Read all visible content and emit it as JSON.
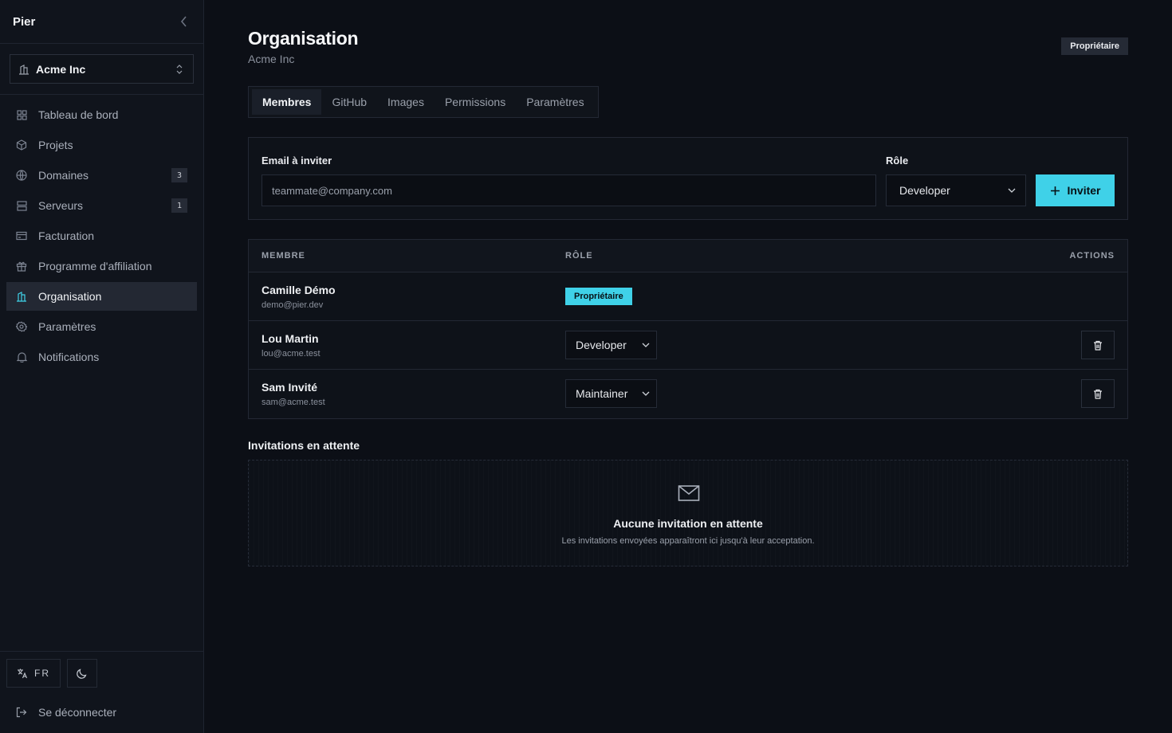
{
  "app": {
    "brand": "Pier"
  },
  "org_switcher": {
    "name": "Acme Inc"
  },
  "nav": [
    {
      "label": "Tableau de bord",
      "icon": "dashboard-icon",
      "count": null
    },
    {
      "label": "Projets",
      "icon": "box-icon",
      "count": null
    },
    {
      "label": "Domaines",
      "icon": "globe-icon",
      "count": "3"
    },
    {
      "label": "Serveurs",
      "icon": "server-icon",
      "count": "1"
    },
    {
      "label": "Facturation",
      "icon": "credit-card-icon",
      "count": null
    },
    {
      "label": "Programme d'affiliation",
      "icon": "gift-icon",
      "count": null
    },
    {
      "label": "Organisation",
      "icon": "building-icon",
      "count": null,
      "active": true
    },
    {
      "label": "Paramètres",
      "icon": "gear-icon",
      "count": null
    },
    {
      "label": "Notifications",
      "icon": "bell-icon",
      "count": null
    }
  ],
  "footer": {
    "language": "FR",
    "logout": "Se déconnecter"
  },
  "page": {
    "title": "Organisation",
    "subtitle": "Acme Inc",
    "role_chip": "Propriétaire"
  },
  "tabs": [
    "Membres",
    "GitHub",
    "Images",
    "Permissions",
    "Paramètres"
  ],
  "invite": {
    "email_label": "Email à inviter",
    "email_placeholder": "teammate@company.com",
    "role_label": "Rôle",
    "role_value": "Developer",
    "button": "Inviter"
  },
  "members": {
    "headers": {
      "member": "MEMBRE",
      "role": "RÔLE",
      "actions": "ACTIONS"
    },
    "rows": [
      {
        "name": "Camille Démo",
        "email": "demo@pier.dev",
        "role": "Propriétaire",
        "owner": true
      },
      {
        "name": "Lou Martin",
        "email": "lou@acme.test",
        "role": "Developer",
        "owner": false
      },
      {
        "name": "Sam Invité",
        "email": "sam@acme.test",
        "role": "Maintainer",
        "owner": false
      }
    ]
  },
  "pending": {
    "title": "Invitations en attente",
    "empty_title": "Aucune invitation en attente",
    "empty_sub": "Les invitations envoyées apparaîtront ici jusqu'à leur acceptation."
  },
  "colors": {
    "accent": "#3fd1e8",
    "background": "#0c0f16",
    "sidebar": "#10141c"
  }
}
